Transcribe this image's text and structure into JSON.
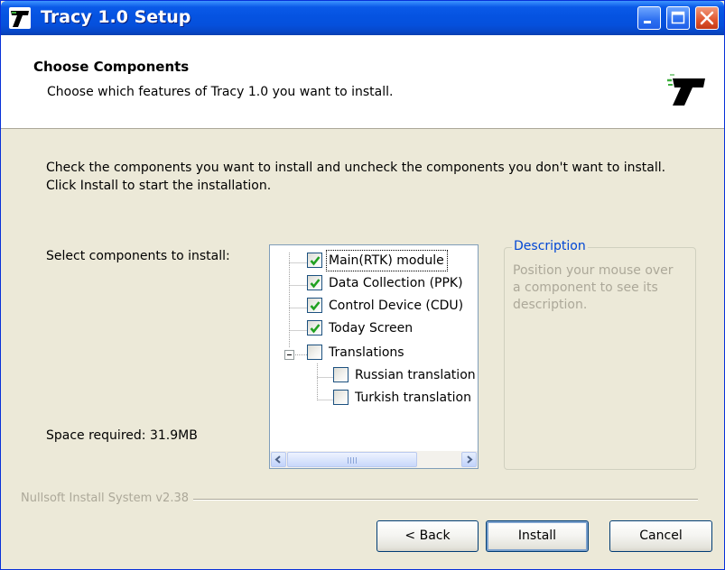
{
  "window": {
    "title": "Tracy 1.0 Setup"
  },
  "header": {
    "title": "Choose Components",
    "subtitle": "Choose which features of Tracy 1.0 you want to install."
  },
  "body": {
    "intro": "Check the components you want to install and uncheck the components you don't want to install. Click Install to start the installation.",
    "select_label": "Select components to install:",
    "space_required": "Space required: 31.9MB"
  },
  "components": [
    {
      "label": "Main(RTK) module",
      "checked": true,
      "selected": true
    },
    {
      "label": "Data Collection (PPK)",
      "checked": true
    },
    {
      "label": "Control Device (CDU)",
      "checked": true
    },
    {
      "label": "Today Screen",
      "checked": true
    },
    {
      "label": "Translations",
      "checked": false,
      "expanded": true
    },
    {
      "label": "Russian translation",
      "checked": false
    },
    {
      "label": "Turkish translation",
      "checked": false
    }
  ],
  "description": {
    "title": "Description",
    "text": "Position your mouse over a component to see its description."
  },
  "footer": {
    "brand": "Nullsoft Install System v2.38",
    "back_label": "< Back",
    "install_label": "Install",
    "cancel_label": "Cancel"
  },
  "colors": {
    "titlebar": "#0553e1",
    "dialog_bg": "#ece9d8",
    "check": "#21a121",
    "description_title": "#0046d5",
    "disabled_text": "#aca899"
  },
  "icons": [
    "tracy-logo-icon",
    "minimize-icon",
    "maximize-icon",
    "close-icon",
    "checkmark-icon",
    "collapse-icon",
    "scroll-left-icon",
    "scroll-right-icon"
  ]
}
